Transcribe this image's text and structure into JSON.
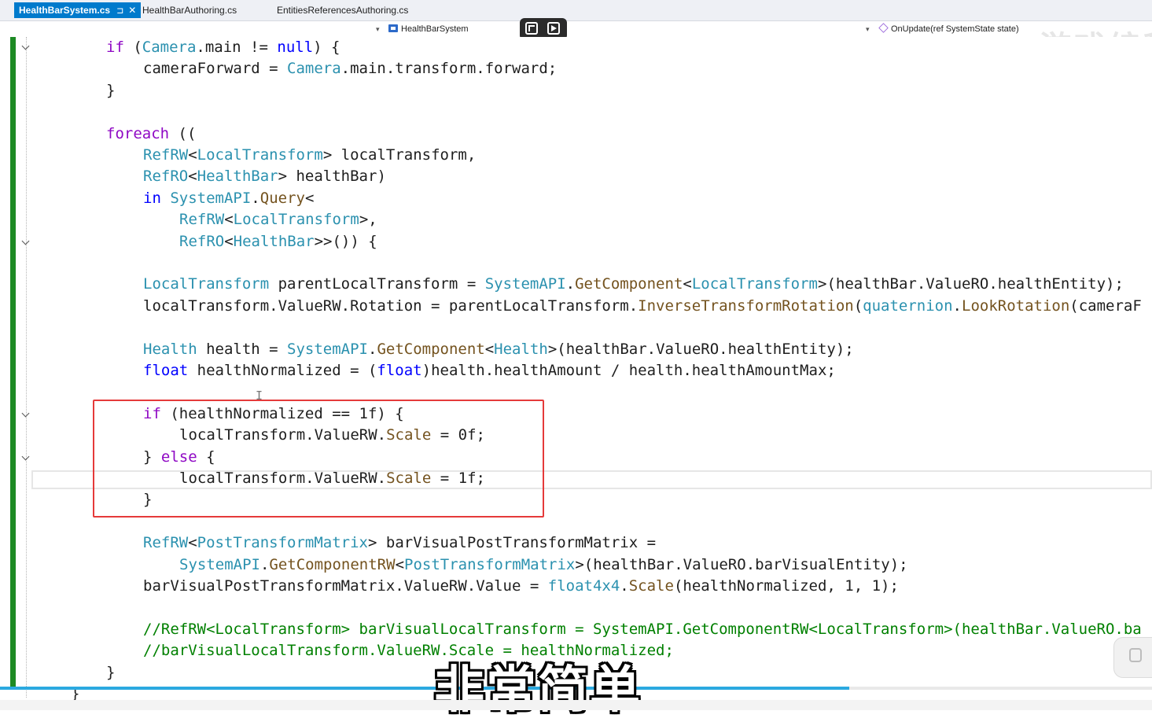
{
  "tabs": [
    {
      "label": "HealthBarSystem.cs",
      "pin_glyph": "⊐",
      "close_glyph": "✕",
      "active": true
    },
    {
      "label": "HealthBarAuthoring.cs",
      "active": false
    },
    {
      "label": "EntitiesReferencesAuthoring.cs",
      "active": false
    }
  ],
  "nav": {
    "type_dropdown": "HealthBarSystem",
    "member_dropdown": "OnUpdate(ref SystemState state)",
    "caret_glyph": "▾"
  },
  "watermark": {
    "text": "一一一游戏编程 bilibili"
  },
  "code_lines": [
    "if (Camera.main != null) {",
    "cameraForward = Camera.main.transform.forward;",
    "}",
    "foreach ((",
    "RefRW<LocalTransform> localTransform,",
    "RefRO<HealthBar> healthBar)",
    "in SystemAPI.Query<",
    "RefRW<LocalTransform>,",
    "RefRO<HealthBar>>()) {",
    "LocalTransform parentLocalTransform = SystemAPI.GetComponent<LocalTransform>(healthBar.ValueRO.healthEntity);",
    "localTransform.ValueRW.Rotation = parentLocalTransform.InverseTransformRotation(quaternion.LookRotation(cameraF",
    "Health health = SystemAPI.GetComponent<Health>(healthBar.ValueRO.healthEntity);",
    "float healthNormalized = (float)health.healthAmount / health.healthAmountMax;",
    "if (healthNormalized == 1f) {",
    "localTransform.ValueRW.Scale = 0f;",
    "} else {",
    "localTransform.ValueRW.Scale = 1f;",
    "}",
    "RefRW<PostTransformMatrix> barVisualPostTransformMatrix =",
    "SystemAPI.GetComponentRW<PostTransformMatrix>(healthBar.ValueRO.barVisualEntity);",
    "barVisualPostTransformMatrix.ValueRW.Value = float4x4.Scale(healthNormalized, 1, 1);",
    "//RefRW<LocalTransform> barVisualLocalTransform = SystemAPI.GetComponentRW<LocalTransform>(healthBar.ValueRO.ba",
    "//barVisualLocalTransform.ValueRW.Scale = healthNormalized;",
    "}",
    "}"
  ],
  "text_cursor_glyph": "I",
  "subtitle": "非常简单",
  "video": {
    "progress": 0.737
  },
  "colors": {
    "keyword": "#0000ff",
    "control": "#8f08c4",
    "type": "#2b91af",
    "method": "#74531f",
    "comment": "#008000",
    "active_tab": "#007acc",
    "change_bar": "#1d8a24",
    "highlight_box": "#e53a3a",
    "progress": "#2ba9e0"
  }
}
